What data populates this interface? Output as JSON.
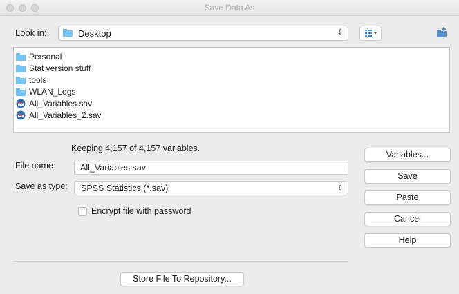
{
  "window": {
    "title": "Save Data As"
  },
  "look_in": {
    "label": "Look in:",
    "value": "Desktop",
    "icon": "folder-icon"
  },
  "files": [
    {
      "name": "Personal",
      "icon": "folder-icon"
    },
    {
      "name": "Stat version stuff",
      "icon": "folder-icon"
    },
    {
      "name": "tools",
      "icon": "folder-icon"
    },
    {
      "name": "WLAN_Logs",
      "icon": "folder-icon"
    },
    {
      "name": "All_Variables.sav",
      "icon": "sav-file-icon"
    },
    {
      "name": "All_Variables_2.sav",
      "icon": "sav-file-icon"
    }
  ],
  "keeping_text": "Keeping 4,157 of 4,157 variables.",
  "file_name": {
    "label": "File name:",
    "value": "All_Variables.sav"
  },
  "save_as_type": {
    "label": "Save as type:",
    "value": "SPSS Statistics (*.sav)"
  },
  "encrypt": {
    "label": "Encrypt file with password",
    "checked": false
  },
  "buttons": {
    "variables": "Variables...",
    "save": "Save",
    "paste": "Paste",
    "cancel": "Cancel",
    "help": "Help",
    "store": "Store File To Repository..."
  },
  "colors": {
    "folder": "#74c3f1",
    "window_bg": "#ececec"
  }
}
